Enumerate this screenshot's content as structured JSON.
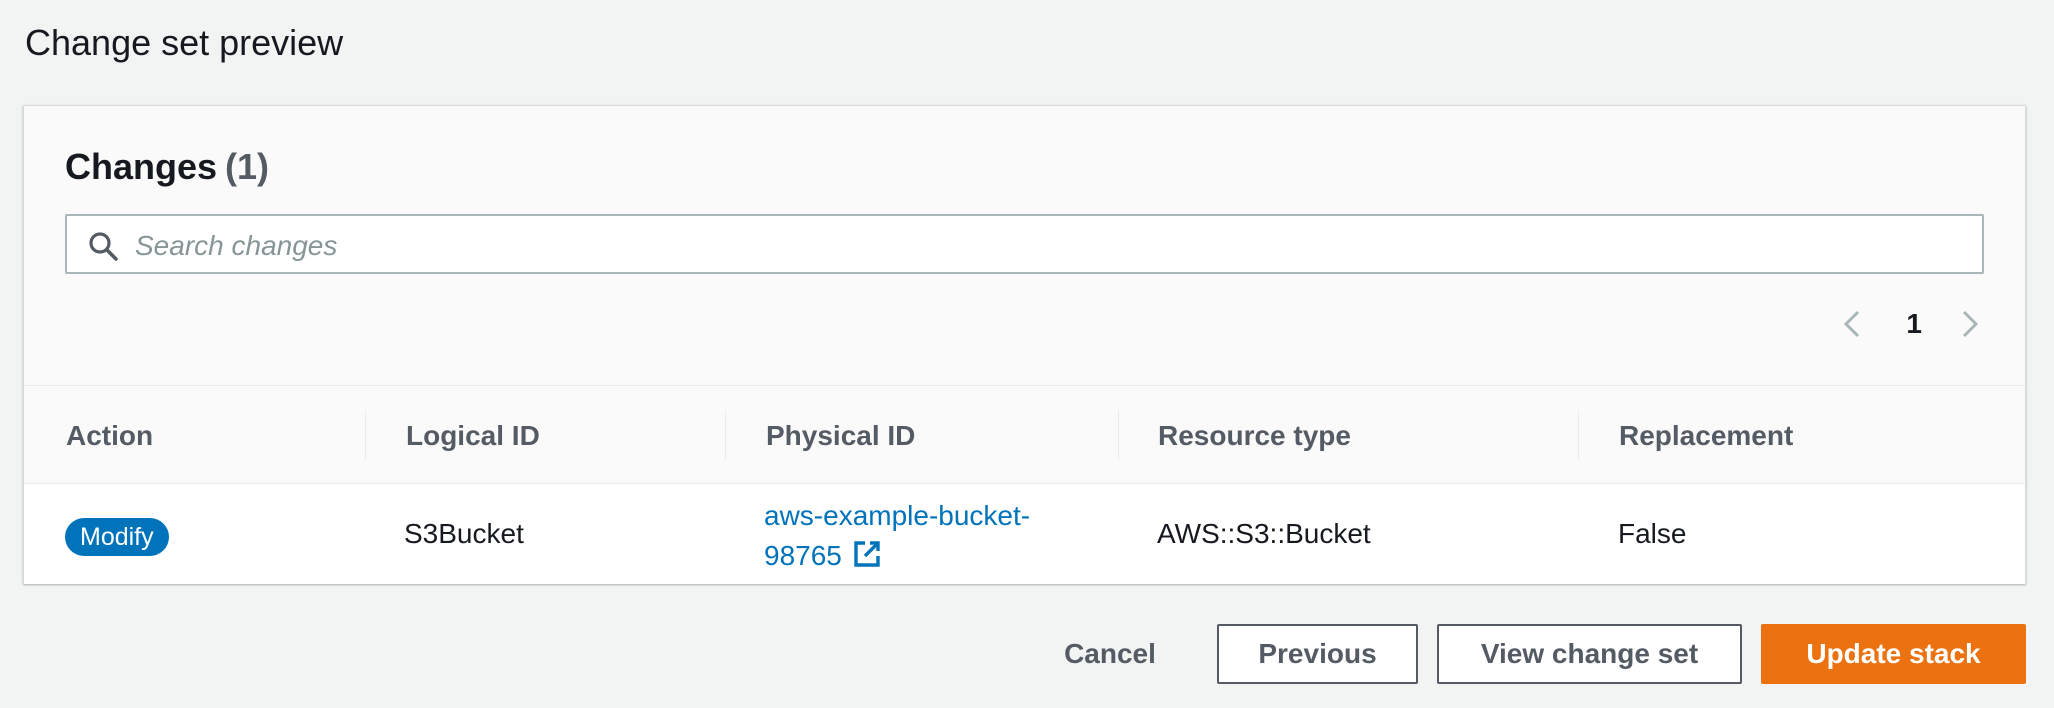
{
  "page": {
    "title": "Change set preview"
  },
  "changes": {
    "title": "Changes",
    "count": "(1)",
    "search": {
      "placeholder": "Search changes",
      "icon": "search-icon"
    },
    "pagination": {
      "current_page": "1"
    }
  },
  "table": {
    "columns": [
      "Action",
      "Logical ID",
      "Physical ID",
      "Resource type",
      "Replacement"
    ],
    "rows": [
      {
        "action": "Modify",
        "logical_id": "S3Bucket",
        "physical_id_line1": "aws-example-bucket-",
        "physical_id_line2": "98765",
        "resource_type": "AWS::S3::Bucket",
        "replacement": "False"
      }
    ]
  },
  "footer": {
    "cancel_label": "Cancel",
    "previous_label": "Previous",
    "view_change_set_label": "View change set",
    "update_stack_label": "Update stack"
  },
  "colors": {
    "primary_button": "#ec7211",
    "badge_blue": "#0073bb",
    "link": "#0073bb"
  }
}
